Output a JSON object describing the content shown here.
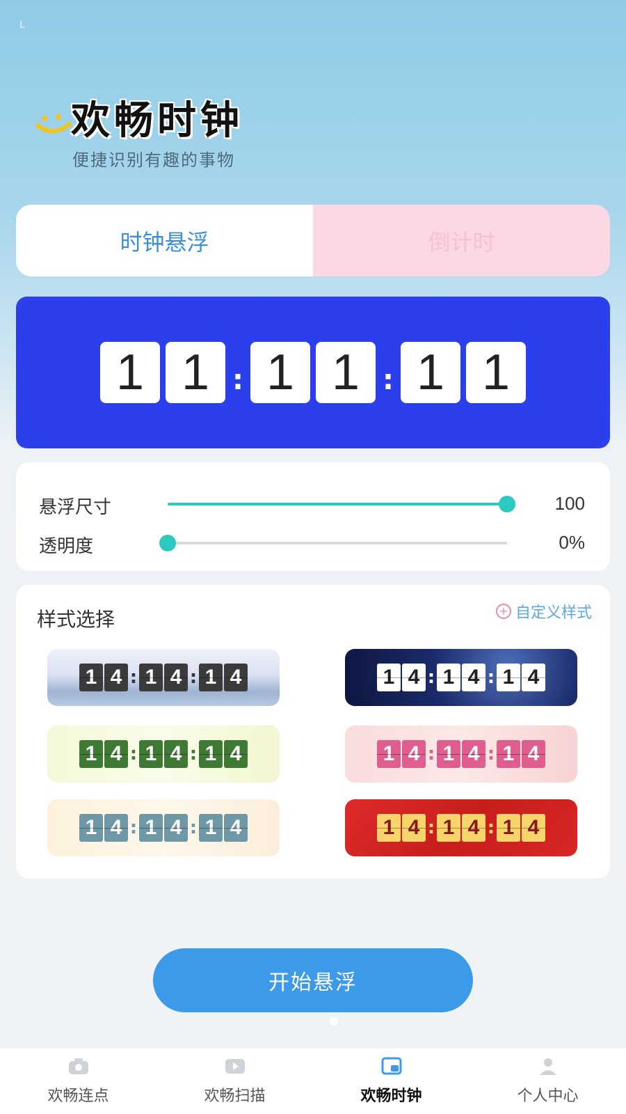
{
  "status": {
    "corner_mark": "L"
  },
  "header": {
    "title": "欢畅时钟",
    "subtitle": "便捷识别有趣的事物"
  },
  "tabs": [
    {
      "label": "时钟悬浮",
      "active": true
    },
    {
      "label": "倒计时",
      "active": false
    }
  ],
  "clock": {
    "digits": [
      "1",
      "1",
      "1",
      "1",
      "1",
      "1"
    ],
    "separator": ":",
    "background": "#2b3fed"
  },
  "settings": {
    "size": {
      "label": "悬浮尺寸",
      "value_text": "100",
      "level": 1.0
    },
    "opacity": {
      "label": "透明度",
      "value_text": "0%",
      "level": 0.0
    },
    "accent": "#2cc9c1"
  },
  "styles": {
    "title": "样式选择",
    "custom_link": "自定义样式",
    "options": [
      {
        "theme": "misty-mountains",
        "digits": [
          "1",
          "4",
          "1",
          "4",
          "1",
          "4"
        ]
      },
      {
        "theme": "starry-night",
        "digits": [
          "1",
          "4",
          "1",
          "4",
          "1",
          "4"
        ]
      },
      {
        "theme": "lime-green",
        "digits": [
          "1",
          "4",
          "1",
          "4",
          "1",
          "4"
        ]
      },
      {
        "theme": "pink",
        "digits": [
          "1",
          "4",
          "1",
          "4",
          "1",
          "4"
        ]
      },
      {
        "theme": "cream-teal",
        "digits": [
          "1",
          "4",
          "1",
          "4",
          "1",
          "4"
        ]
      },
      {
        "theme": "red-gold",
        "digits": [
          "1",
          "4",
          "1",
          "4",
          "1",
          "4"
        ]
      }
    ]
  },
  "start_button": {
    "label": "开始悬浮",
    "color": "#3d9ae8"
  },
  "nav": {
    "items": [
      {
        "label": "欢畅连点",
        "icon": "camera-icon",
        "active": false
      },
      {
        "label": "欢畅扫描",
        "icon": "video-icon",
        "active": false
      },
      {
        "label": "欢畅时钟",
        "icon": "floating-window-icon",
        "active": true
      },
      {
        "label": "个人中心",
        "icon": "person-icon",
        "active": false
      }
    ]
  }
}
